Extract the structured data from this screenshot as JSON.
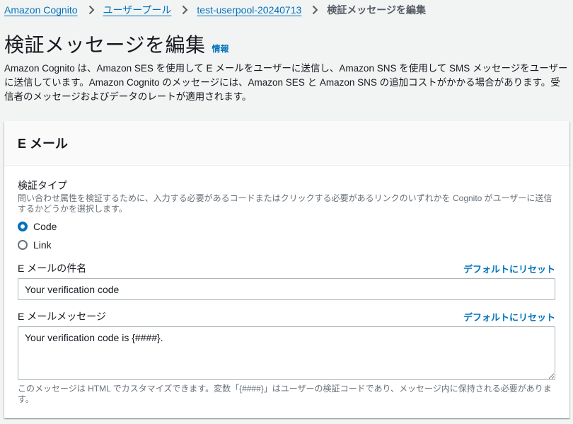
{
  "breadcrumb": {
    "items": [
      "Amazon Cognito",
      "ユーザープール",
      "test-userpool-20240713"
    ],
    "current": "検証メッセージを編集"
  },
  "header": {
    "title": "検証メッセージを編集",
    "info_link": "情報"
  },
  "description": "Amazon Cognito は、Amazon SES を使用して E メールをユーザーに送信し、Amazon SNS を使用して SMS メッセージをユーザーに送信しています。Amazon Cognito のメッセージには、Amazon SES と Amazon SNS の追加コストがかかる場合があります。受信者のメッセージおよびデータのレートが適用されます。",
  "email_panel": {
    "title": "E メール",
    "verification_type": {
      "label": "検証タイプ",
      "description": "問い合わせ属性を検証するために、入力する必要があるコードまたはクリックする必要があるリンクのいずれかを Cognito がユーザーに送信するかどうかを選択します。",
      "options": [
        {
          "label": "Code",
          "selected": true
        },
        {
          "label": "Link",
          "selected": false
        }
      ]
    },
    "subject": {
      "label": "E メールの件名",
      "reset_link": "デフォルトにリセット",
      "value": "Your verification code"
    },
    "message": {
      "label": "E メールメッセージ",
      "reset_link": "デフォルトにリセット",
      "value": "Your verification code is {####}.",
      "constraint": "このメッセージは HTML でカスタマイズできます。変数「{####}」はユーザーの検証コードであり、メッセージ内に保持される必要があります。"
    }
  },
  "colors": {
    "link": "#0073bb",
    "page_background": "#f2f3f3",
    "text": "#16191f",
    "secondary_text": "#687078"
  }
}
